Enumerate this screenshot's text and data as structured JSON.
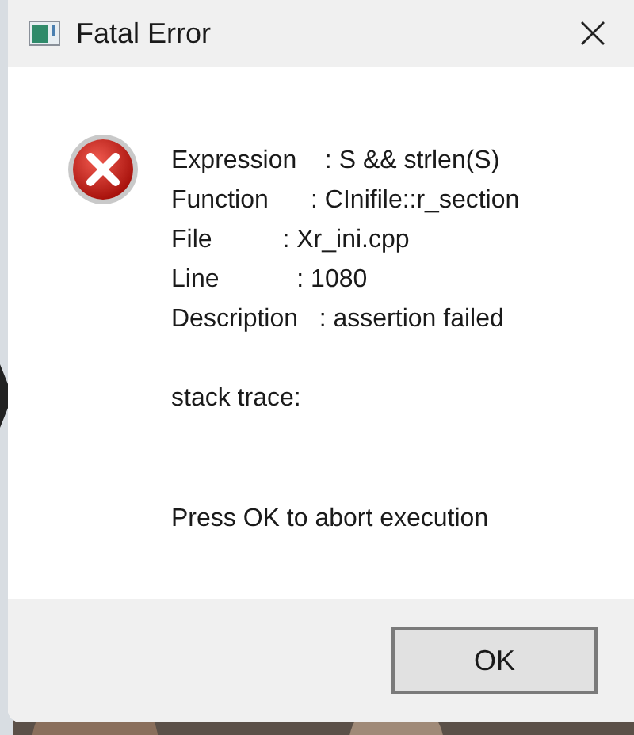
{
  "window": {
    "title": "Fatal Error"
  },
  "dialog": {
    "kind": "error",
    "lines": [
      "Expression    : S && strlen(S)",
      "Function      : CInifile::r_section",
      "File          : Xr_ini.cpp",
      "Line           : 1080",
      "Description   : assertion failed"
    ],
    "trace_label": "stack trace:",
    "message": "Press OK to abort execution"
  },
  "buttons": [
    "OK"
  ]
}
